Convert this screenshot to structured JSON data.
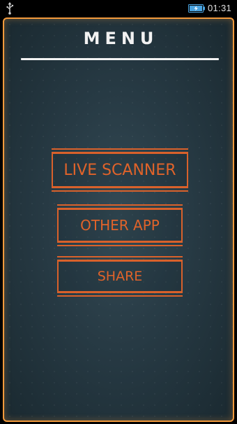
{
  "status_bar": {
    "time": "01:31",
    "usb_icon": "usb-icon",
    "battery_icon": "battery-icon"
  },
  "menu": {
    "title": "MENU",
    "buttons": [
      {
        "label": "LIVE SCANNER"
      },
      {
        "label": "OTHER APP"
      },
      {
        "label": "SHARE"
      }
    ]
  },
  "colors": {
    "accent": "#e0632a",
    "frame": "#f39a3c",
    "background": "#273a44",
    "title": "#f2f2f2"
  }
}
